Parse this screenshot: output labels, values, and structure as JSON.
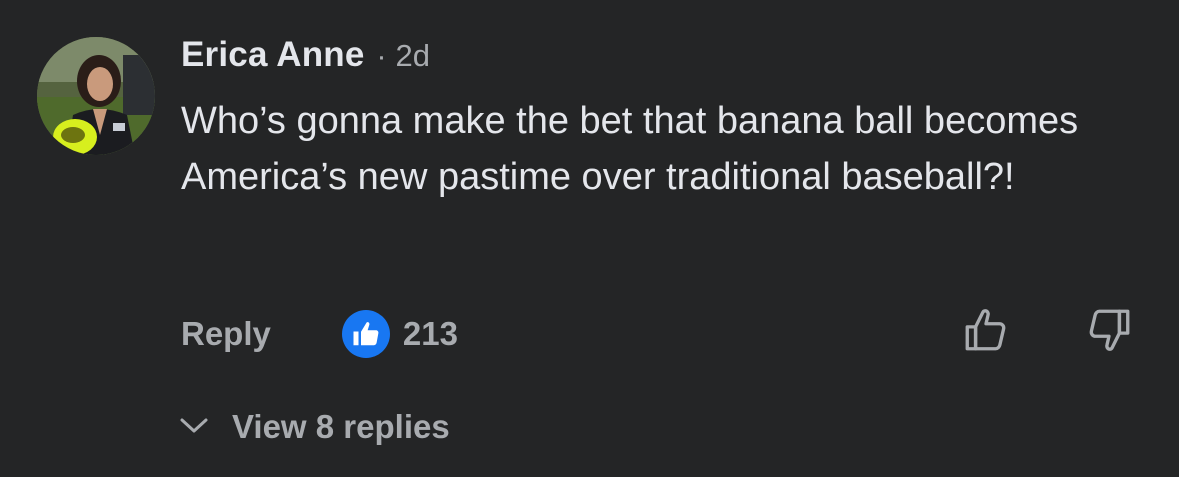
{
  "comment": {
    "author": "Erica Anne",
    "separator": "·",
    "timestamp": "2d",
    "text": "Who’s gonna make the bet that banana ball becomes America’s new pastime over traditional baseball?!",
    "actions": {
      "reply_label": "Reply",
      "reaction_icon": "thumbs-up-icon",
      "reaction_count": "213",
      "upvote_icon": "thumbs-up-outline-icon",
      "downvote_icon": "thumbs-down-outline-icon"
    },
    "replies": {
      "label": "View 8 replies",
      "icon": "chevron-down-icon"
    }
  },
  "colors": {
    "background": "#242526",
    "primary_text": "#e4e6eb",
    "secondary_text": "#a8abaf",
    "reaction_blue": "#1877f2"
  }
}
